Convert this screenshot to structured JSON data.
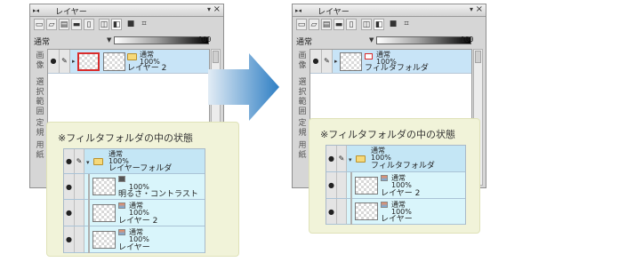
{
  "panels": [
    {
      "title": "レイヤー",
      "blend_mode": "通常",
      "opacity": "100",
      "side_tabs": [
        "画像",
        "選択範囲",
        "定規",
        "用紙"
      ],
      "layers": [
        {
          "mode": "通常",
          "opacity": "100%",
          "name": "レイヤー 2",
          "selected": true
        }
      ]
    },
    {
      "title": "レイヤー",
      "blend_mode": "通常",
      "opacity": "100",
      "side_tabs": [
        "画像",
        "選択範囲",
        "定規",
        "用紙"
      ],
      "layers": [
        {
          "mode": "通常",
          "opacity": "100%",
          "name": "フィルタフォルダ",
          "selected": true
        }
      ]
    }
  ],
  "callouts": [
    {
      "title": "※フィルタフォルダの中の状態",
      "rows": [
        {
          "mode": "通常",
          "opacity": "100%",
          "name": "レイヤーフォルダ"
        },
        {
          "mode": "",
          "opacity": "100%",
          "name": "明るさ・コントラスト"
        },
        {
          "mode": "通常",
          "opacity": "100%",
          "name": "レイヤー 2"
        },
        {
          "mode": "通常",
          "opacity": "100%",
          "name": "レイヤー"
        }
      ]
    },
    {
      "title": "※フィルタフォルダの中の状態",
      "rows": [
        {
          "mode": "通常",
          "opacity": "100%",
          "name": "フィルタフォルダ"
        },
        {
          "mode": "通常",
          "opacity": "100%",
          "name": "レイヤー 2"
        },
        {
          "mode": "通常",
          "opacity": "100%",
          "name": "レイヤー"
        }
      ]
    }
  ],
  "icons": {
    "eye": "eye-icon",
    "pen": "pen-icon",
    "folder": "folder-icon",
    "lock": "lock-icon",
    "arrow": "right-arrow-icon"
  },
  "colors": {
    "selected_row": "#c8e4f7",
    "selection_border": "#d92b2b",
    "arrow_start": "#dbe8f3",
    "arrow_end": "#2f7fc4",
    "callout_bg": "#f1f3d9"
  }
}
